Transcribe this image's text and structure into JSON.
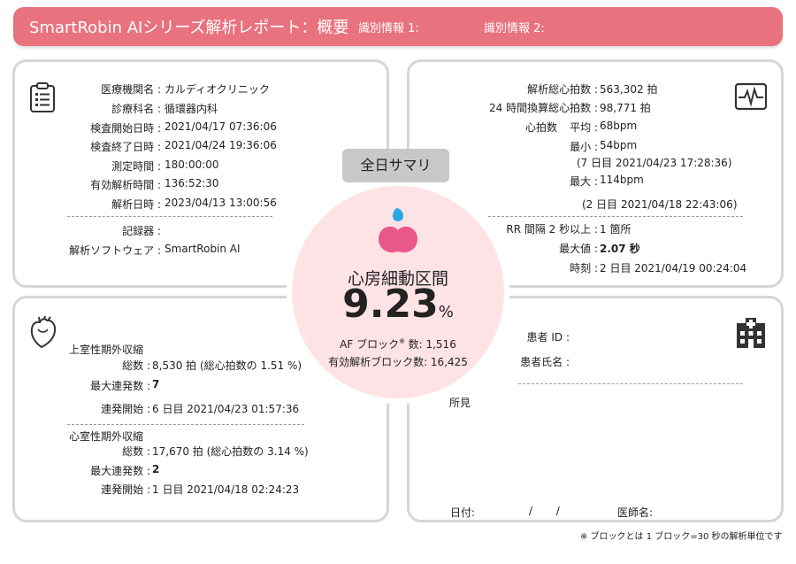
{
  "header": {
    "title": "SmartRobin AIシリーズ解析レポート：概要",
    "id1_label": "識別情報 1:",
    "id2_label": "識別情報 2:"
  },
  "exam": {
    "rows": [
      {
        "label": "医療機関名 :",
        "value": "カルディオクリニック"
      },
      {
        "label": "診療科名 :",
        "value": "循環器内科"
      },
      {
        "label": "検査開始日時 :",
        "value": "2021/04/17 07:36:06"
      },
      {
        "label": "検査終了日時 :",
        "value": "2021/04/24 19:36:06"
      },
      {
        "label": "測定時間 :",
        "value": "180:00:00"
      },
      {
        "label": "有効解析時間 :",
        "value": "136:52:30"
      },
      {
        "label": "解析日時 :",
        "value": "2023/04/13 13:00:56"
      }
    ],
    "recorder_label": "記録器 :",
    "recorder_value": "",
    "software_label": "解析ソフトウェア :",
    "software_value": "SmartRobin AI"
  },
  "heart": {
    "total_label": "解析総心拍数 :",
    "total_value": "563,302 拍",
    "beats24_label": "24 時間換算総心拍数 :",
    "beats24_value": "98,771 拍",
    "hr_label": "心拍数",
    "avg_label": "平均 :",
    "avg_value": "68bpm",
    "min_label": "最小 :",
    "min_value": "54bpm",
    "min_time": "(7 日目 2021/04/23 17:28:36)",
    "max_label": "最大 :",
    "max_value": "114bpm",
    "max_time": "(2 日目 2021/04/18 22:43:06)",
    "rr_label": "RR 間隔 2 秒以上 :",
    "rr_value": "1 箇所",
    "rrmax_label": "最大値 :",
    "rrmax_value": "2.07 秒",
    "rrtime_label": "時刻 :",
    "rrtime_value": "2 日目 2021/04/19 00:24:04"
  },
  "summary": {
    "button": "全日サマリ",
    "label": "心房細動区間",
    "value": "9.23",
    "unit": "%",
    "af_label": "AF ブロック",
    "af_mark": "※",
    "af_suffix": " 数: 1,516",
    "valid_blocks": "有効解析ブロック数: 16,425"
  },
  "ectopic": {
    "sv_title": "上室性期外収縮",
    "sv_total_label": "総数 :",
    "sv_total_value": "8,530 拍 (総心拍数の 1.51 %)",
    "sv_max_label": "最大連発数 :",
    "sv_max_value": "7",
    "sv_start_label": "連発開始 :",
    "sv_start_value": "6 日目 2021/04/23 01:57:36",
    "v_title": "心室性期外収縮",
    "v_total_label": "総数 :",
    "v_total_value": "17,670 拍 (総心拍数の 3.14 %)",
    "v_max_label": "最大連発数 :",
    "v_max_value": "2",
    "v_start_label": "連発開始 :",
    "v_start_value": "1 日目 2021/04/18 02:24:23"
  },
  "patient": {
    "id_label": "患者 ID :",
    "name_label": "患者氏名 :",
    "findings_label": "所見",
    "date_label": "日付:",
    "date_sep": "/       /",
    "doctor_label": "医師名:"
  },
  "footnote": "※ ブロックとは 1 ブロック=30 秒の解析単位です",
  "colors": {
    "header": "#e8727e",
    "circle": "#fde3e6",
    "button": "#c8c8c8",
    "drop_blue": "#29a9e0",
    "drop_pink": "#e8588a"
  },
  "icons": {
    "clipboard": "clipboard-icon",
    "ecg": "ecg-monitor-icon",
    "heart": "heart-icon",
    "hospital": "hospital-icon"
  }
}
